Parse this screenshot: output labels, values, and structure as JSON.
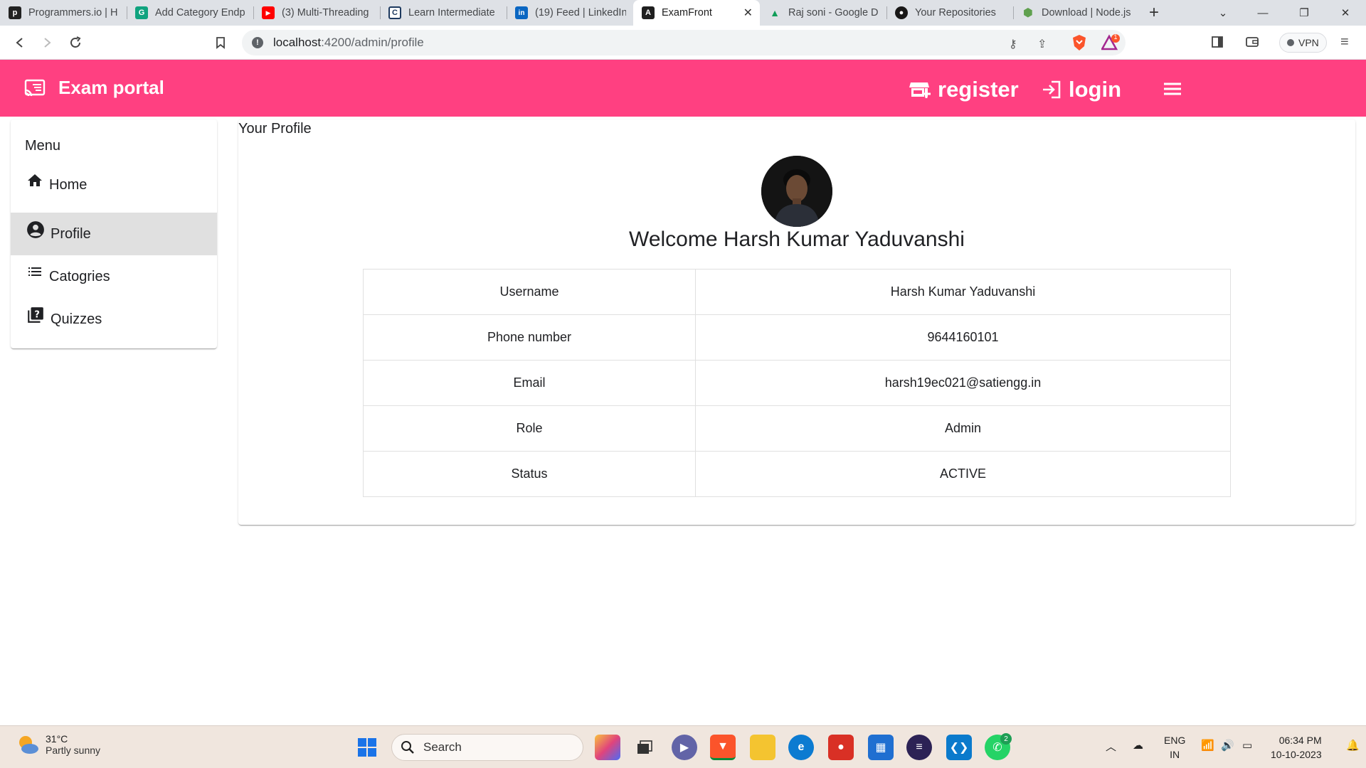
{
  "browser": {
    "tabs": [
      {
        "title": "Programmers.io | H",
        "favicon": "p",
        "color": "#222222"
      },
      {
        "title": "Add Category Endp",
        "favicon": "G",
        "color": "#10a37f"
      },
      {
        "title": "(3) Multi-Threading",
        "favicon": "▶",
        "color": "#ff0000"
      },
      {
        "title": "Learn Intermediate",
        "favicon": "C",
        "color": "#1e3a5f"
      },
      {
        "title": "(19) Feed | LinkedIn",
        "favicon": "in",
        "color": "#0a66c2"
      },
      {
        "title": "ExamFront",
        "favicon": "A",
        "color": "#1f1f1f"
      },
      {
        "title": "Raj soni - Google D",
        "favicon": "▲",
        "color": "#0f9d58"
      },
      {
        "title": "Your Repositories",
        "favicon": "●",
        "color": "#181717"
      },
      {
        "title": "Download | Node.js",
        "favicon": "⬢",
        "color": "#5fa04e"
      }
    ],
    "active_tab_index": 5,
    "url_host": "localhost",
    "url_rest": ":4200/admin/profile",
    "vpn_label": "VPN",
    "brave_badge": "1"
  },
  "header": {
    "brand": "Exam portal",
    "register_label": "register",
    "login_label": "login"
  },
  "sidebar": {
    "title": "Menu",
    "items": [
      {
        "label": "Home",
        "icon": "home-icon"
      },
      {
        "label": "Profile",
        "icon": "account-circle-icon",
        "active": true
      },
      {
        "label": "Catogries",
        "icon": "list-icon"
      },
      {
        "label": "Quizzes",
        "icon": "quiz-icon"
      }
    ]
  },
  "profile": {
    "card_title": "Your Profile",
    "welcome": "Welcome Harsh Kumar Yaduvanshi",
    "rows": [
      {
        "label": "Username",
        "value": "Harsh Kumar Yaduvanshi"
      },
      {
        "label": "Phone number",
        "value": "9644160101"
      },
      {
        "label": "Email",
        "value": "harsh19ec021@satiengg.in"
      },
      {
        "label": "Role",
        "value": "Admin"
      },
      {
        "label": "Status",
        "value": "ACTIVE"
      }
    ]
  },
  "taskbar": {
    "temperature": "31°C",
    "weather": "Partly sunny",
    "search_placeholder": "Search",
    "language": "ENG",
    "region": "IN",
    "time": "06:34 PM",
    "date": "10-10-2023",
    "whatsapp_badge": "2"
  },
  "colors": {
    "primary": "#ff4081",
    "active_menu_bg": "#e0e0e0"
  }
}
